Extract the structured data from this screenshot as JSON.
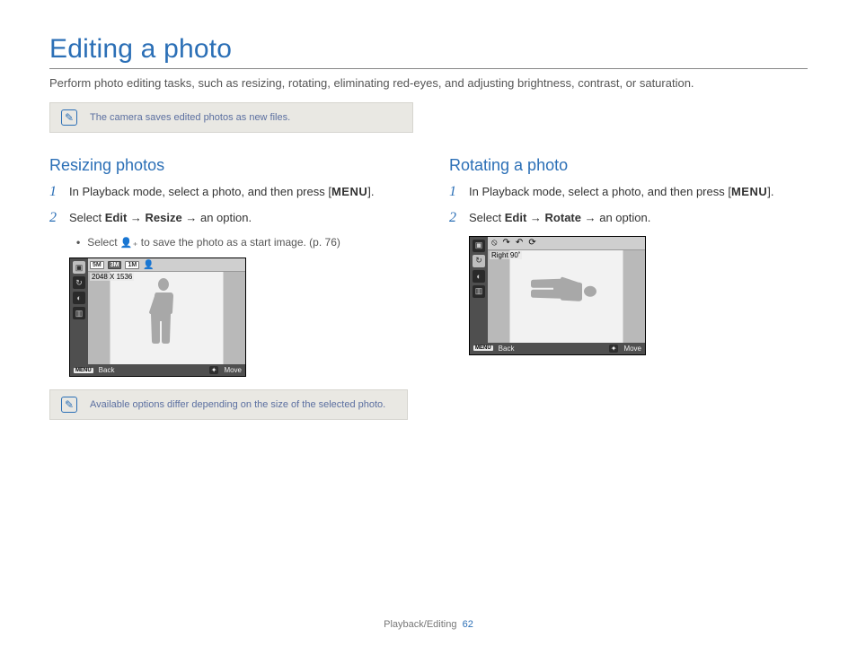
{
  "title": "Editing a photo",
  "intro": "Perform photo editing tasks, such as resizing, rotating, eliminating red-eyes, and adjusting brightness, contrast, or saturation.",
  "note1": "The camera saves edited photos as new files.",
  "left": {
    "heading": "Resizing photos",
    "step1_a": "In Playback mode, select a photo, and then press ",
    "menu": "MENU",
    "step1_b": ".",
    "step2_pre": "Select ",
    "step2_edit": "Edit",
    "step2_arrow1": " → ",
    "step2_resize": "Resize",
    "step2_arrow2": " → an option.",
    "bullet_pre": "Select ",
    "bullet_post": " to save the photo as a start image. (p. 76)",
    "lcd": {
      "chips": [
        "5M",
        "3M",
        "1M"
      ],
      "label": "2048 X 1536",
      "back": "Back",
      "move": "Move",
      "menu_badge": "MENU"
    },
    "note2": "Available options differ depending on the size of the selected photo."
  },
  "right": {
    "heading": "Rotating a photo",
    "step1_a": "In Playback mode, select a photo, and then press ",
    "menu": "MENU",
    "step1_b": ".",
    "step2_pre": "Select ",
    "step2_edit": "Edit",
    "step2_arrow1": " → ",
    "step2_rotate": "Rotate",
    "step2_arrow2": " → an option.",
    "lcd": {
      "label": "Right 90˚",
      "back": "Back",
      "move": "Move",
      "menu_badge": "MENU"
    }
  },
  "footer": {
    "section": "Playback/Editing",
    "page": "62"
  },
  "step_numbers": {
    "one": "1",
    "two": "2"
  }
}
